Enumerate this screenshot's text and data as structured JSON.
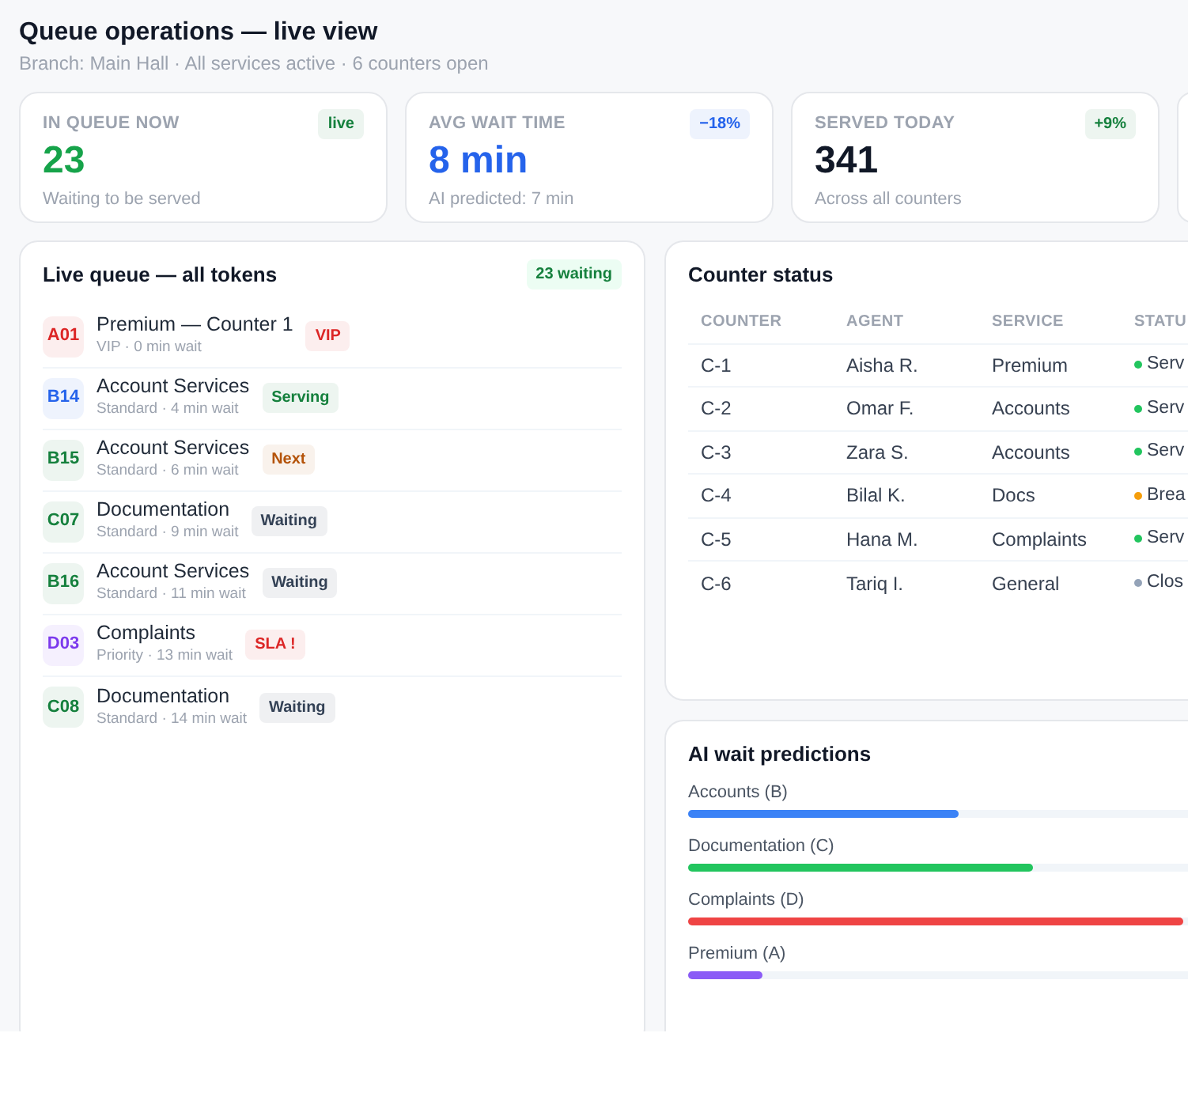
{
  "header": {
    "title": "Queue operations — live view",
    "subtitle": "Branch: Main Hall · All services active · 6 counters open"
  },
  "stats": [
    {
      "label": "IN QUEUE NOW",
      "value": "23",
      "color": "#16a34a",
      "note": "Waiting to be served",
      "badge": {
        "text": "live",
        "color": "#15803d"
      }
    },
    {
      "label": "AVG WAIT TIME",
      "value": "8 min",
      "color": "#2563eb",
      "note": "AI predicted: 7 min",
      "badge": {
        "text": "−18%",
        "color": "#2563eb"
      }
    },
    {
      "label": "SERVED TODAY",
      "value": "341",
      "color": "#111827",
      "note": "Across all counters",
      "badge": {
        "text": "+9%",
        "color": "#15803d"
      }
    }
  ],
  "queue": {
    "title": "Live queue — all tokens",
    "count": "23 waiting",
    "items": [
      {
        "token": "A01",
        "color": "#dc2626",
        "service": "Premium — Counter 1",
        "meta": "VIP · 0 min wait",
        "tag": {
          "text": "VIP",
          "color": "#dc2626"
        }
      },
      {
        "token": "B14",
        "color": "#2563eb",
        "service": "Account Services",
        "meta": "Standard · 4 min wait",
        "tag": {
          "text": "Serving",
          "color": "#15803d"
        }
      },
      {
        "token": "B15",
        "color": "#15803d",
        "service": "Account Services",
        "meta": "Standard · 6 min wait",
        "tag": {
          "text": "Next",
          "color": "#b45309"
        }
      },
      {
        "token": "C07",
        "color": "#15803d",
        "service": "Documentation",
        "meta": "Standard · 9 min wait",
        "tag": {
          "text": "Waiting",
          "color": "#334155"
        }
      },
      {
        "token": "B16",
        "color": "#15803d",
        "service": "Account Services",
        "meta": "Standard · 11 min wait",
        "tag": {
          "text": "Waiting",
          "color": "#334155"
        }
      },
      {
        "token": "D03",
        "color": "#7c3aed",
        "service": "Complaints",
        "meta": "Priority · 13 min wait",
        "tag": {
          "text": "SLA !",
          "color": "#dc2626"
        }
      },
      {
        "token": "C08",
        "color": "#15803d",
        "service": "Documentation",
        "meta": "Standard · 14 min wait",
        "tag": {
          "text": "Waiting",
          "color": "#334155"
        }
      }
    ]
  },
  "counters": {
    "title": "Counter status",
    "columns": [
      "COUNTER",
      "AGENT",
      "SERVICE",
      "STATU"
    ],
    "rows": [
      {
        "counter": "C-1",
        "agent": "Aisha R.",
        "service": "Premium",
        "status": "Serv",
        "color": "#22c55e"
      },
      {
        "counter": "C-2",
        "agent": "Omar F.",
        "service": "Accounts",
        "status": "Serv",
        "color": "#22c55e"
      },
      {
        "counter": "C-3",
        "agent": "Zara S.",
        "service": "Accounts",
        "status": "Serv",
        "color": "#22c55e"
      },
      {
        "counter": "C-4",
        "agent": "Bilal K.",
        "service": "Docs",
        "status": "Brea",
        "color": "#f59e0b"
      },
      {
        "counter": "C-5",
        "agent": "Hana M.",
        "service": "Complaints",
        "status": "Serv",
        "color": "#22c55e"
      },
      {
        "counter": "C-6",
        "agent": "Tariq I.",
        "service": "General",
        "status": "Clos",
        "color": "#94a3b8"
      }
    ]
  },
  "predictions": {
    "title": "AI wait predictions",
    "items": [
      {
        "label": "Accounts (B)",
        "level": 0.54,
        "color": "#3b82f6"
      },
      {
        "label": "Documentation (C)",
        "level": 0.69,
        "color": "#22c55e"
      },
      {
        "label": "Complaints (D)",
        "level": 0.99,
        "color": "#ef4444"
      },
      {
        "label": "Premium (A)",
        "level": 0.15,
        "color": "#8b5cf6"
      }
    ]
  }
}
